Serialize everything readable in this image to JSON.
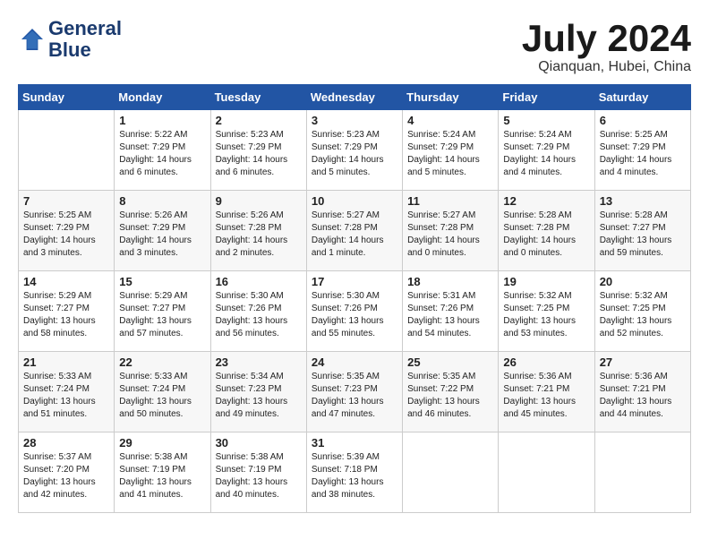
{
  "header": {
    "logo_line1": "General",
    "logo_line2": "Blue",
    "month_title": "July 2024",
    "location": "Qianquan, Hubei, China"
  },
  "calendar": {
    "days_of_week": [
      "Sunday",
      "Monday",
      "Tuesday",
      "Wednesday",
      "Thursday",
      "Friday",
      "Saturday"
    ],
    "weeks": [
      [
        {
          "day": "",
          "content": ""
        },
        {
          "day": "1",
          "content": "Sunrise: 5:22 AM\nSunset: 7:29 PM\nDaylight: 14 hours\nand 6 minutes."
        },
        {
          "day": "2",
          "content": "Sunrise: 5:23 AM\nSunset: 7:29 PM\nDaylight: 14 hours\nand 6 minutes."
        },
        {
          "day": "3",
          "content": "Sunrise: 5:23 AM\nSunset: 7:29 PM\nDaylight: 14 hours\nand 5 minutes."
        },
        {
          "day": "4",
          "content": "Sunrise: 5:24 AM\nSunset: 7:29 PM\nDaylight: 14 hours\nand 5 minutes."
        },
        {
          "day": "5",
          "content": "Sunrise: 5:24 AM\nSunset: 7:29 PM\nDaylight: 14 hours\nand 4 minutes."
        },
        {
          "day": "6",
          "content": "Sunrise: 5:25 AM\nSunset: 7:29 PM\nDaylight: 14 hours\nand 4 minutes."
        }
      ],
      [
        {
          "day": "7",
          "content": "Sunrise: 5:25 AM\nSunset: 7:29 PM\nDaylight: 14 hours\nand 3 minutes."
        },
        {
          "day": "8",
          "content": "Sunrise: 5:26 AM\nSunset: 7:29 PM\nDaylight: 14 hours\nand 3 minutes."
        },
        {
          "day": "9",
          "content": "Sunrise: 5:26 AM\nSunset: 7:28 PM\nDaylight: 14 hours\nand 2 minutes."
        },
        {
          "day": "10",
          "content": "Sunrise: 5:27 AM\nSunset: 7:28 PM\nDaylight: 14 hours\nand 1 minute."
        },
        {
          "day": "11",
          "content": "Sunrise: 5:27 AM\nSunset: 7:28 PM\nDaylight: 14 hours\nand 0 minutes."
        },
        {
          "day": "12",
          "content": "Sunrise: 5:28 AM\nSunset: 7:28 PM\nDaylight: 14 hours\nand 0 minutes."
        },
        {
          "day": "13",
          "content": "Sunrise: 5:28 AM\nSunset: 7:27 PM\nDaylight: 13 hours\nand 59 minutes."
        }
      ],
      [
        {
          "day": "14",
          "content": "Sunrise: 5:29 AM\nSunset: 7:27 PM\nDaylight: 13 hours\nand 58 minutes."
        },
        {
          "day": "15",
          "content": "Sunrise: 5:29 AM\nSunset: 7:27 PM\nDaylight: 13 hours\nand 57 minutes."
        },
        {
          "day": "16",
          "content": "Sunrise: 5:30 AM\nSunset: 7:26 PM\nDaylight: 13 hours\nand 56 minutes."
        },
        {
          "day": "17",
          "content": "Sunrise: 5:30 AM\nSunset: 7:26 PM\nDaylight: 13 hours\nand 55 minutes."
        },
        {
          "day": "18",
          "content": "Sunrise: 5:31 AM\nSunset: 7:26 PM\nDaylight: 13 hours\nand 54 minutes."
        },
        {
          "day": "19",
          "content": "Sunrise: 5:32 AM\nSunset: 7:25 PM\nDaylight: 13 hours\nand 53 minutes."
        },
        {
          "day": "20",
          "content": "Sunrise: 5:32 AM\nSunset: 7:25 PM\nDaylight: 13 hours\nand 52 minutes."
        }
      ],
      [
        {
          "day": "21",
          "content": "Sunrise: 5:33 AM\nSunset: 7:24 PM\nDaylight: 13 hours\nand 51 minutes."
        },
        {
          "day": "22",
          "content": "Sunrise: 5:33 AM\nSunset: 7:24 PM\nDaylight: 13 hours\nand 50 minutes."
        },
        {
          "day": "23",
          "content": "Sunrise: 5:34 AM\nSunset: 7:23 PM\nDaylight: 13 hours\nand 49 minutes."
        },
        {
          "day": "24",
          "content": "Sunrise: 5:35 AM\nSunset: 7:23 PM\nDaylight: 13 hours\nand 47 minutes."
        },
        {
          "day": "25",
          "content": "Sunrise: 5:35 AM\nSunset: 7:22 PM\nDaylight: 13 hours\nand 46 minutes."
        },
        {
          "day": "26",
          "content": "Sunrise: 5:36 AM\nSunset: 7:21 PM\nDaylight: 13 hours\nand 45 minutes."
        },
        {
          "day": "27",
          "content": "Sunrise: 5:36 AM\nSunset: 7:21 PM\nDaylight: 13 hours\nand 44 minutes."
        }
      ],
      [
        {
          "day": "28",
          "content": "Sunrise: 5:37 AM\nSunset: 7:20 PM\nDaylight: 13 hours\nand 42 minutes."
        },
        {
          "day": "29",
          "content": "Sunrise: 5:38 AM\nSunset: 7:19 PM\nDaylight: 13 hours\nand 41 minutes."
        },
        {
          "day": "30",
          "content": "Sunrise: 5:38 AM\nSunset: 7:19 PM\nDaylight: 13 hours\nand 40 minutes."
        },
        {
          "day": "31",
          "content": "Sunrise: 5:39 AM\nSunset: 7:18 PM\nDaylight: 13 hours\nand 38 minutes."
        },
        {
          "day": "",
          "content": ""
        },
        {
          "day": "",
          "content": ""
        },
        {
          "day": "",
          "content": ""
        }
      ]
    ]
  }
}
